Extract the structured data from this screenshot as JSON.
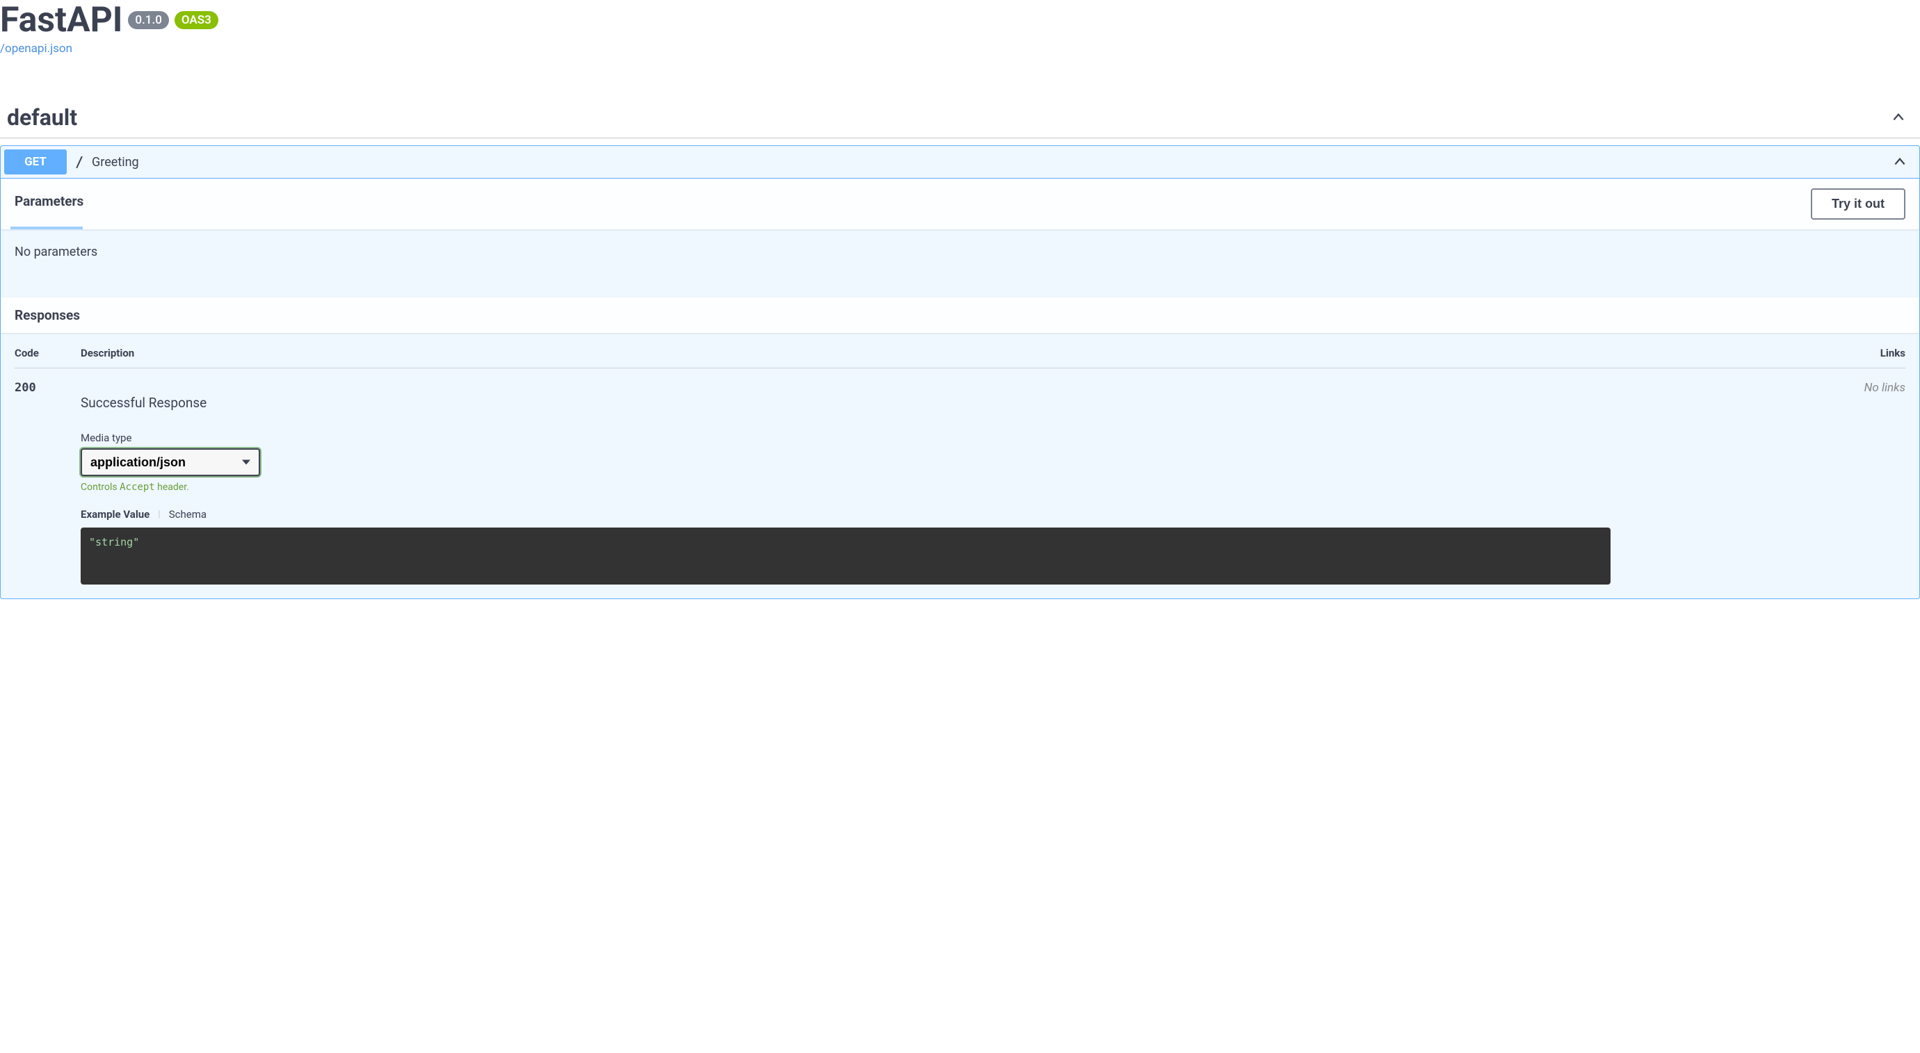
{
  "header": {
    "title": "FastAPI",
    "version": "0.1.0",
    "oas_badge": "OAS3",
    "openapi_link": "/openapi.json"
  },
  "section": {
    "name": "default"
  },
  "operation": {
    "method": "GET",
    "path": "/",
    "summary": "Greeting"
  },
  "parameters": {
    "tab_label": "Parameters",
    "try_button": "Try it out",
    "empty_text": "No parameters"
  },
  "responses": {
    "header": "Responses",
    "columns": {
      "code": "Code",
      "description": "Description",
      "links": "Links"
    },
    "row": {
      "code": "200",
      "description": "Successful Response",
      "links": "No links"
    },
    "media_type_label": "Media type",
    "media_type_value": "application/json",
    "accept_hint_prefix": "Controls ",
    "accept_hint_code": "Accept",
    "accept_hint_suffix": " header.",
    "example_tabs": {
      "example_value": "Example Value",
      "schema": "Schema"
    },
    "example_body": "\"string\""
  }
}
